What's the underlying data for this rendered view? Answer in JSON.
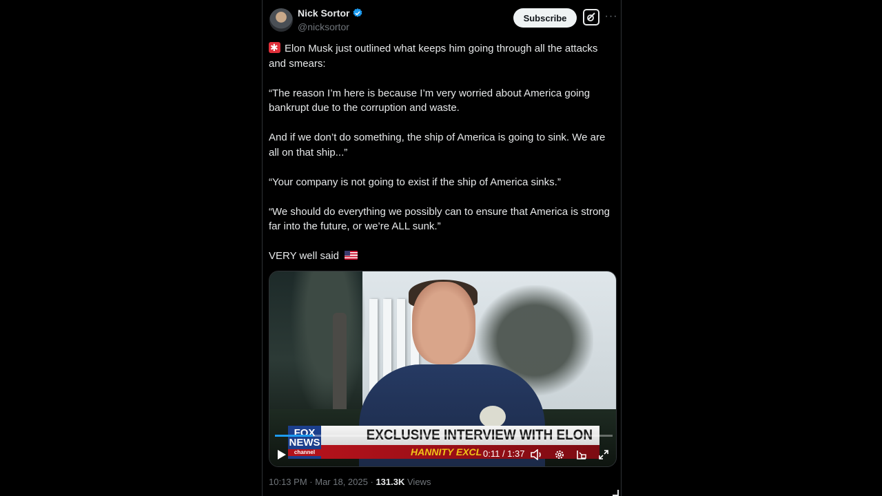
{
  "author": {
    "name": "Nick Sortor",
    "handle": "@nicksortor",
    "verified_color": "#1d9bf0"
  },
  "actions": {
    "subscribe_label": "Subscribe",
    "grok_icon": "grok-icon",
    "more_icon": "more-icon"
  },
  "tweet": {
    "lines": [
      "Elon Musk just outlined what keeps him going through all the attacks and smears:",
      "“The reason I’m here is because I’m very worried about America going bankrupt due to the corruption and waste.",
      "And if we don’t do something, the ship of America is going to sink. We are all on that ship...”",
      "“Your company is not going to exist if the ship of America sinks.”",
      "“We should do everything we possibly can to ensure that America is strong far into the future, or we’re ALL sunk.”",
      "VERY well said"
    ]
  },
  "video": {
    "network_logo": "FOX NEWS",
    "network_channel": "channel",
    "headline": "EXCLUSIVE INTERVIEW WITH ELON MUSK",
    "lower_third": "HANNITY EXCL",
    "time_display": "0:11 / 1:37",
    "progress": 0.113
  },
  "meta": {
    "time": "10:13 PM",
    "date": "Mar 18, 2025",
    "views_count": "131.3K",
    "views_label": "Views",
    "separator": "·"
  }
}
